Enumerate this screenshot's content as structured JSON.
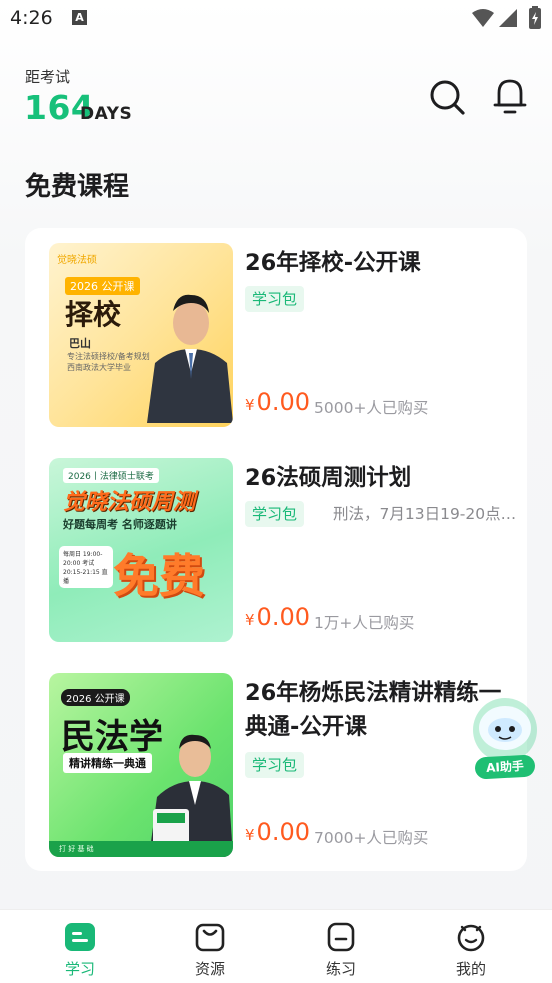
{
  "status_bar": {
    "time": "4:26",
    "notification_icon": "A"
  },
  "header": {
    "countdown_label": "距考试",
    "countdown_days": "164",
    "countdown_unit": "DAYS",
    "search_icon": "search-icon",
    "bell_icon": "bell-icon"
  },
  "section": {
    "title": "免费课程"
  },
  "courses": [
    {
      "title": "26年择校-公开课",
      "tag": "学习包",
      "desc": "",
      "price_symbol": "¥",
      "price": "0.00",
      "buyers": "5000+人已购买",
      "thumb": {
        "brand": "觉晓法硕",
        "year": "2026 公开课",
        "big": "择校",
        "who": "巴山",
        "intro": "专注法硕择校/备考规划 西南政法大学毕业"
      }
    },
    {
      "title": "26法硕周测计划",
      "tag": "学习包",
      "desc": "刑法，7月13日19-20点…",
      "price_symbol": "¥",
      "price": "0.00",
      "buyers": "1万+人已购买",
      "thumb": {
        "top": "2026丨法律硕士联考",
        "big": "觉晓法硕周测",
        "sub": "好题每周考 名师逐题讲",
        "card": "每周日 19:00-20:00 考试 20:15-21:15 直播",
        "free": "免费"
      }
    },
    {
      "title": "26年杨烁民法精讲精练一典通-公开课",
      "tag": "学习包",
      "desc": "",
      "price_symbol": "¥",
      "price": "0.00",
      "buyers": "7000+人已购买",
      "thumb": {
        "year": "2026 公开课",
        "big": "民法学",
        "sub": "精讲精练一典通",
        "foot": "打 好 基 础"
      }
    }
  ],
  "ai_assistant": {
    "label": "AI助手"
  },
  "bottom_nav": [
    {
      "label": "学习",
      "active": true
    },
    {
      "label": "资源",
      "active": false
    },
    {
      "label": "练习",
      "active": false
    },
    {
      "label": "我的",
      "active": false
    }
  ],
  "colors": {
    "accent": "#19b877",
    "price": "#ff5a1f",
    "countdown": "#17c07a"
  }
}
